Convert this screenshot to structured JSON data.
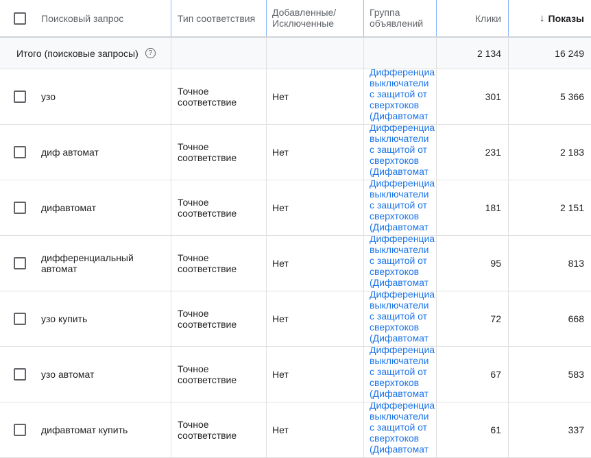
{
  "header": {
    "query": "Поисковый запрос",
    "match_type": "Тип соответствия",
    "added_line1": "Добавленные/",
    "added_line2": "Исключенные",
    "group_line1": "Группа",
    "group_line2": "объявлений",
    "clicks": "Клики",
    "impressions": "Показы",
    "sort_arrow": "↓"
  },
  "totals": {
    "label": "Итого (поисковые запросы)",
    "help_icon": "?",
    "clicks": "2 134",
    "impressions": "16 249"
  },
  "colors": {
    "link": "#1a73e8",
    "header_divider": "#8ab4f8"
  },
  "rows": [
    {
      "query": "узо",
      "match_l1": "Точное",
      "match_l2": "соответствие",
      "added": "Нет",
      "group": [
        "Дифференциа",
        "выключатели",
        "с защитой от",
        "сверхтоков",
        "(Дифавтомат"
      ],
      "clicks": "301",
      "impressions": "5 366"
    },
    {
      "query": "диф автомат",
      "match_l1": "Точное",
      "match_l2": "соответствие",
      "added": "Нет",
      "group": [
        "Дифференциа",
        "выключатели",
        "с защитой от",
        "сверхтоков",
        "(Дифавтомат"
      ],
      "clicks": "231",
      "impressions": "2 183"
    },
    {
      "query": "дифавтомат",
      "match_l1": "Точное",
      "match_l2": "соответствие",
      "added": "Нет",
      "group": [
        "Дифференциа",
        "выключатели",
        "с защитой от",
        "сверхтоков",
        "(Дифавтомат"
      ],
      "clicks": "181",
      "impressions": "2 151"
    },
    {
      "query": "дифференциальный автомат",
      "match_l1": "Точное",
      "match_l2": "соответствие",
      "added": "Нет",
      "group": [
        "Дифференциа",
        "выключатели",
        "с защитой от",
        "сверхтоков",
        "(Дифавтомат"
      ],
      "clicks": "95",
      "impressions": "813"
    },
    {
      "query": "узо купить",
      "match_l1": "Точное",
      "match_l2": "соответствие",
      "added": "Нет",
      "group": [
        "Дифференциа",
        "выключатели",
        "с защитой от",
        "сверхтоков",
        "(Дифавтомат"
      ],
      "clicks": "72",
      "impressions": "668"
    },
    {
      "query": "узо автомат",
      "match_l1": "Точное",
      "match_l2": "соответствие",
      "added": "Нет",
      "group": [
        "Дифференциа",
        "выключатели",
        "с защитой от",
        "сверхтоков",
        "(Дифавтомат"
      ],
      "clicks": "67",
      "impressions": "583"
    },
    {
      "query": "дифавтомат купить",
      "match_l1": "Точное",
      "match_l2": "соответствие",
      "added": "Нет",
      "group": [
        "Дифференциа",
        "выключатели",
        "с защитой от",
        "сверхтоков",
        "(Дифавтомат"
      ],
      "clicks": "61",
      "impressions": "337"
    }
  ]
}
